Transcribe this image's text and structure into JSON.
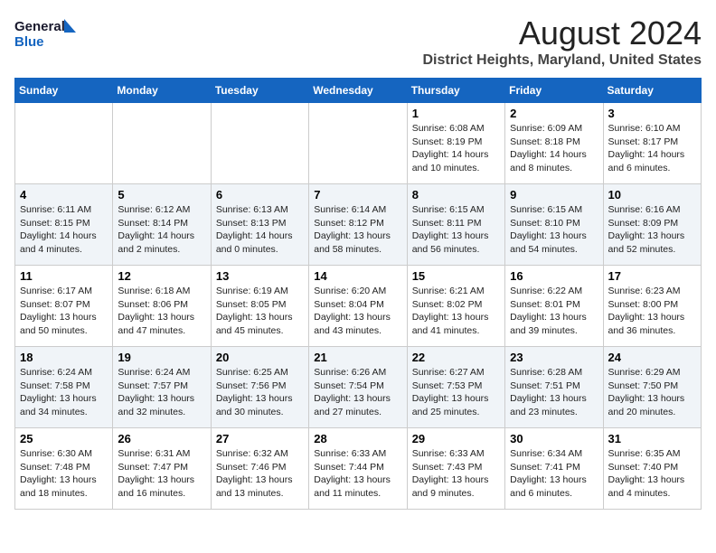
{
  "logo": {
    "line1": "General",
    "line2": "Blue"
  },
  "title": "August 2024",
  "subtitle": "District Heights, Maryland, United States",
  "headers": [
    "Sunday",
    "Monday",
    "Tuesday",
    "Wednesday",
    "Thursday",
    "Friday",
    "Saturday"
  ],
  "weeks": [
    [
      {
        "day": "",
        "info": ""
      },
      {
        "day": "",
        "info": ""
      },
      {
        "day": "",
        "info": ""
      },
      {
        "day": "",
        "info": ""
      },
      {
        "day": "1",
        "info": "Sunrise: 6:08 AM\nSunset: 8:19 PM\nDaylight: 14 hours\nand 10 minutes."
      },
      {
        "day": "2",
        "info": "Sunrise: 6:09 AM\nSunset: 8:18 PM\nDaylight: 14 hours\nand 8 minutes."
      },
      {
        "day": "3",
        "info": "Sunrise: 6:10 AM\nSunset: 8:17 PM\nDaylight: 14 hours\nand 6 minutes."
      }
    ],
    [
      {
        "day": "4",
        "info": "Sunrise: 6:11 AM\nSunset: 8:15 PM\nDaylight: 14 hours\nand 4 minutes."
      },
      {
        "day": "5",
        "info": "Sunrise: 6:12 AM\nSunset: 8:14 PM\nDaylight: 14 hours\nand 2 minutes."
      },
      {
        "day": "6",
        "info": "Sunrise: 6:13 AM\nSunset: 8:13 PM\nDaylight: 14 hours\nand 0 minutes."
      },
      {
        "day": "7",
        "info": "Sunrise: 6:14 AM\nSunset: 8:12 PM\nDaylight: 13 hours\nand 58 minutes."
      },
      {
        "day": "8",
        "info": "Sunrise: 6:15 AM\nSunset: 8:11 PM\nDaylight: 13 hours\nand 56 minutes."
      },
      {
        "day": "9",
        "info": "Sunrise: 6:15 AM\nSunset: 8:10 PM\nDaylight: 13 hours\nand 54 minutes."
      },
      {
        "day": "10",
        "info": "Sunrise: 6:16 AM\nSunset: 8:09 PM\nDaylight: 13 hours\nand 52 minutes."
      }
    ],
    [
      {
        "day": "11",
        "info": "Sunrise: 6:17 AM\nSunset: 8:07 PM\nDaylight: 13 hours\nand 50 minutes."
      },
      {
        "day": "12",
        "info": "Sunrise: 6:18 AM\nSunset: 8:06 PM\nDaylight: 13 hours\nand 47 minutes."
      },
      {
        "day": "13",
        "info": "Sunrise: 6:19 AM\nSunset: 8:05 PM\nDaylight: 13 hours\nand 45 minutes."
      },
      {
        "day": "14",
        "info": "Sunrise: 6:20 AM\nSunset: 8:04 PM\nDaylight: 13 hours\nand 43 minutes."
      },
      {
        "day": "15",
        "info": "Sunrise: 6:21 AM\nSunset: 8:02 PM\nDaylight: 13 hours\nand 41 minutes."
      },
      {
        "day": "16",
        "info": "Sunrise: 6:22 AM\nSunset: 8:01 PM\nDaylight: 13 hours\nand 39 minutes."
      },
      {
        "day": "17",
        "info": "Sunrise: 6:23 AM\nSunset: 8:00 PM\nDaylight: 13 hours\nand 36 minutes."
      }
    ],
    [
      {
        "day": "18",
        "info": "Sunrise: 6:24 AM\nSunset: 7:58 PM\nDaylight: 13 hours\nand 34 minutes."
      },
      {
        "day": "19",
        "info": "Sunrise: 6:24 AM\nSunset: 7:57 PM\nDaylight: 13 hours\nand 32 minutes."
      },
      {
        "day": "20",
        "info": "Sunrise: 6:25 AM\nSunset: 7:56 PM\nDaylight: 13 hours\nand 30 minutes."
      },
      {
        "day": "21",
        "info": "Sunrise: 6:26 AM\nSunset: 7:54 PM\nDaylight: 13 hours\nand 27 minutes."
      },
      {
        "day": "22",
        "info": "Sunrise: 6:27 AM\nSunset: 7:53 PM\nDaylight: 13 hours\nand 25 minutes."
      },
      {
        "day": "23",
        "info": "Sunrise: 6:28 AM\nSunset: 7:51 PM\nDaylight: 13 hours\nand 23 minutes."
      },
      {
        "day": "24",
        "info": "Sunrise: 6:29 AM\nSunset: 7:50 PM\nDaylight: 13 hours\nand 20 minutes."
      }
    ],
    [
      {
        "day": "25",
        "info": "Sunrise: 6:30 AM\nSunset: 7:48 PM\nDaylight: 13 hours\nand 18 minutes."
      },
      {
        "day": "26",
        "info": "Sunrise: 6:31 AM\nSunset: 7:47 PM\nDaylight: 13 hours\nand 16 minutes."
      },
      {
        "day": "27",
        "info": "Sunrise: 6:32 AM\nSunset: 7:46 PM\nDaylight: 13 hours\nand 13 minutes."
      },
      {
        "day": "28",
        "info": "Sunrise: 6:33 AM\nSunset: 7:44 PM\nDaylight: 13 hours\nand 11 minutes."
      },
      {
        "day": "29",
        "info": "Sunrise: 6:33 AM\nSunset: 7:43 PM\nDaylight: 13 hours\nand 9 minutes."
      },
      {
        "day": "30",
        "info": "Sunrise: 6:34 AM\nSunset: 7:41 PM\nDaylight: 13 hours\nand 6 minutes."
      },
      {
        "day": "31",
        "info": "Sunrise: 6:35 AM\nSunset: 7:40 PM\nDaylight: 13 hours\nand 4 minutes."
      }
    ]
  ]
}
